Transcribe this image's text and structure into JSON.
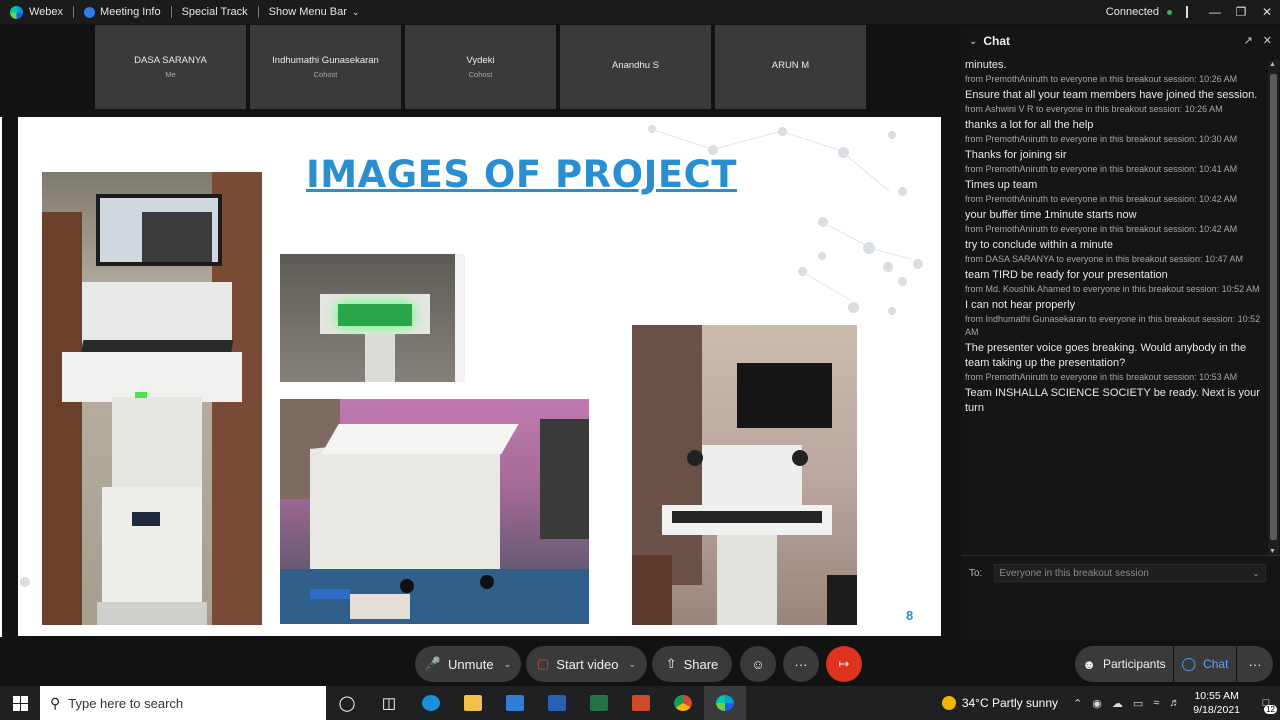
{
  "titlebar": {
    "app_name": "Webex",
    "meeting_info": "Meeting Info",
    "special_track": "Special Track",
    "show_menu_bar": "Show Menu Bar",
    "status": "Connected"
  },
  "participants": [
    {
      "name": "DASA SARANYA",
      "role": "Me"
    },
    {
      "name": "Indhumathi Gunasekaran",
      "role": "Cohost"
    },
    {
      "name": "Vydeki",
      "role": "Cohost"
    },
    {
      "name": "Anandhu S",
      "role": ""
    },
    {
      "name": "ARUN M",
      "role": ""
    }
  ],
  "slide": {
    "title": "IMAGES OF PROJECT",
    "page_number": "8"
  },
  "chat": {
    "title": "Chat",
    "messages": [
      {
        "text": "minutes.",
        "from": "from PremothAniruth to everyone in this breakout session:    10:26 AM"
      },
      {
        "text": "Ensure that all your team members have joined the session.",
        "from": "from Ashwini V R to everyone in this breakout session:    10:26 AM"
      },
      {
        "text": "thanks a lot for all the help",
        "from": "from PremothAniruth to everyone in this breakout session:    10:30 AM"
      },
      {
        "text": "Thanks for joining sir",
        "from": "from PremothAniruth to everyone in this breakout session:    10:41 AM"
      },
      {
        "text": "Times up team",
        "from": "from PremothAniruth to everyone in this breakout session:    10:42 AM"
      },
      {
        "text": "your buffer time 1minute  starts now",
        "from": "from PremothAniruth to everyone in this breakout session:    10:42 AM"
      },
      {
        "text": "try to conclude within a minute",
        "from": "from DASA SARANYA to everyone in this breakout session:    10:47 AM"
      },
      {
        "text": "team TIRD be ready for your presentation",
        "from": "from Md. Koushik Ahamed to everyone in this breakout session: 10:52 AM"
      },
      {
        "text": "I can not hear properly",
        "from": "from Indhumathi Gunasekaran to everyone in this breakout session: 10:52 AM"
      },
      {
        "text": "The presenter voice goes breaking. Would anybody in the team taking up the presentation?",
        "from": "from PremothAniruth to everyone in this breakout session:    10:53 AM"
      },
      {
        "text": "Team INSHALLA SCIENCE SOCIETY be ready. Next is your turn",
        "from": ""
      }
    ],
    "to_label": "To:",
    "to_value": "Everyone in this breakout session"
  },
  "controls": {
    "unmute": "Unmute",
    "start_video": "Start video",
    "share": "Share",
    "participants": "Participants",
    "chat": "Chat"
  },
  "taskbar": {
    "search_placeholder": "Type here to search",
    "weather": "34°C  Partly sunny",
    "time": "10:55 AM",
    "date": "9/18/2021",
    "notifications": "12"
  }
}
